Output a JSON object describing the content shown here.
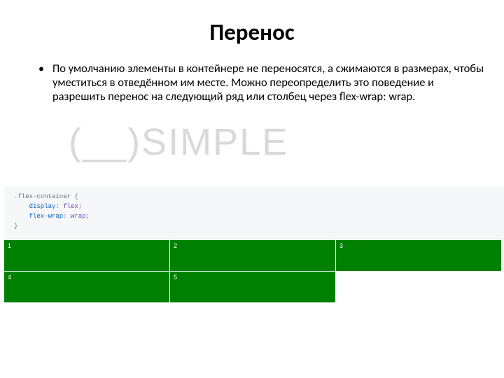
{
  "title": "Перенос",
  "bullet": {
    "marker": "•",
    "text": "По умолчанию элементы в контейнере не переносятся, а сжимаются в размерах, чтобы уместиться в отведённом им месте. Можно переопределить это поведение и разрешить перенос на следующий ряд или столбец через flex-wrap: wrap."
  },
  "watermark": {
    "open": "(",
    "underscore": "__",
    "close": ")",
    "text": "SIMPLE"
  },
  "code": {
    "selector": ".flex-container {",
    "prop1": "    display",
    "val1": "flex",
    "prop2": "    flex-wrap",
    "val2": "wrap",
    "close": "}"
  },
  "boxes": [
    "1",
    "2",
    "3",
    "4",
    "5"
  ]
}
